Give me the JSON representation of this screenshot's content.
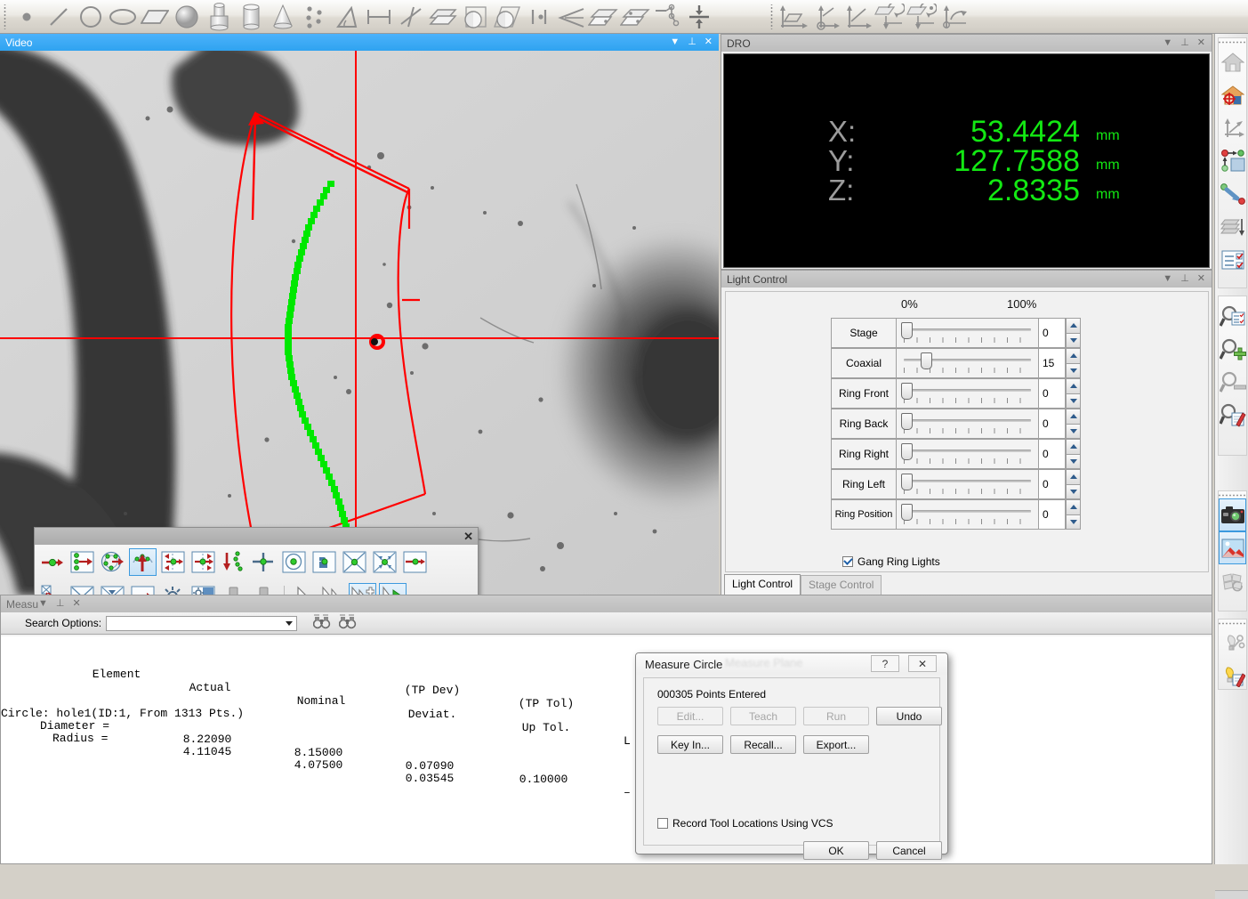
{
  "app": {
    "colors": {
      "active_title": "#3FA9F5",
      "inactive_title": "#C4C4C4",
      "dro_value": "#13E813",
      "dro_label": "#9B9B9B",
      "overlay_red": "#FF0000",
      "overlay_green": "#00E800",
      "selection_blue": "#3C9ADE"
    }
  },
  "top_toolbar": {
    "groups": [
      {
        "name": "geometry-primitives",
        "buttons": [
          {
            "name": "point-icon",
            "tip": "Point"
          },
          {
            "name": "line-icon",
            "tip": "Line"
          },
          {
            "name": "circle-icon",
            "tip": "Circle"
          },
          {
            "name": "ellipse-icon",
            "tip": "Ellipse"
          },
          {
            "name": "plane-icon",
            "tip": "Plane"
          },
          {
            "name": "sphere-icon",
            "tip": "Sphere"
          },
          {
            "name": "cylinder-step-icon",
            "tip": "Stepped Cylinder"
          },
          {
            "name": "cylinder-icon",
            "tip": "Cylinder"
          },
          {
            "name": "cone-icon",
            "tip": "Cone"
          },
          {
            "name": "point-cloud-icon",
            "tip": "Point Cloud"
          },
          {
            "name": "angle-icon",
            "tip": "Angle"
          },
          {
            "name": "distance-icon",
            "tip": "Distance"
          },
          {
            "name": "intersect-line-icon",
            "tip": "Intersection"
          },
          {
            "name": "plane-offset-icon",
            "tip": "Offset Plane"
          },
          {
            "name": "sphere-project-icon",
            "tip": "Project to Sphere"
          },
          {
            "name": "sphere-project-plane-icon",
            "tip": "Project Sphere to Plane"
          },
          {
            "name": "symmetry-icon",
            "tip": "Symmetry"
          },
          {
            "name": "cone-angle-icon",
            "tip": "Cone Angle"
          },
          {
            "name": "plane-dot-icon",
            "tip": "Plane Feature"
          },
          {
            "name": "plane-dot2-icon",
            "tip": "Plane Feature 2"
          },
          {
            "name": "chain-point-icon",
            "tip": "Chain Point"
          },
          {
            "name": "midplane-icon",
            "tip": "Mid Plane"
          }
        ]
      },
      {
        "name": "coordinate-systems",
        "buttons": [
          {
            "name": "align-plane-axis-icon",
            "tip": "Align Plane to Axis"
          },
          {
            "name": "align-origin-icon",
            "tip": "Set Origin"
          },
          {
            "name": "align-axis-icon",
            "tip": "Align Axis"
          },
          {
            "name": "rotate-csys-icon",
            "tip": "Rotate Coordinate System"
          },
          {
            "name": "rotate-csys-2-icon",
            "tip": "Rotate Coordinate System 2"
          },
          {
            "name": "csys-level-icon",
            "tip": "Level Coordinate System"
          }
        ]
      }
    ]
  },
  "video_panel": {
    "title": "Video",
    "active": true,
    "title_buttons": [
      "menu-chevron",
      "pin",
      "close"
    ],
    "overlay": {
      "crosshair_label": "stage-crosshair",
      "measurement_tool": "arc-scan-region",
      "detected_points_color": "#00E800",
      "search_region_color": "#FF0000"
    }
  },
  "floating_toolbar": {
    "name": "measurement-tools-palette",
    "close_label": "✕",
    "row1": [
      {
        "name": "tool-point-probe",
        "selected": false
      },
      {
        "name": "tool-multi-point-line",
        "selected": false
      },
      {
        "name": "tool-circle-scan",
        "selected": false
      },
      {
        "name": "tool-arc-scan",
        "selected": true
      },
      {
        "name": "tool-edge-left",
        "selected": false
      },
      {
        "name": "tool-edge-right",
        "selected": false
      },
      {
        "name": "tool-point-chain",
        "selected": false
      },
      {
        "name": "tool-crosshair-target",
        "selected": false
      },
      {
        "name": "tool-circle-center",
        "selected": false
      },
      {
        "name": "tool-pattern-match",
        "selected": false
      },
      {
        "name": "tool-box-scan",
        "selected": false
      },
      {
        "name": "tool-radial-scan",
        "selected": false
      },
      {
        "name": "tool-linear-scan",
        "selected": false
      }
    ],
    "row2": [
      {
        "name": "tool-measure-network",
        "selected": false
      },
      {
        "name": "tool-box-cross",
        "selected": false
      },
      {
        "name": "tool-box-converge",
        "selected": false
      },
      {
        "name": "tool-direction-arrow",
        "selected": false
      },
      {
        "name": "tool-brightness",
        "selected": false
      },
      {
        "name": "tool-contrast",
        "selected": false
      },
      {
        "name": "tool-touch-probe",
        "selected": false
      },
      {
        "name": "tool-touch-probe-2",
        "selected": false
      },
      {
        "name": "tool-select-pointer",
        "selected": false
      },
      {
        "name": "tool-multi-select",
        "selected": false
      },
      {
        "name": "tool-add-select",
        "selected": true
      },
      {
        "name": "tool-run-select",
        "selected": true
      }
    ]
  },
  "dro": {
    "title": "DRO",
    "title_buttons": [
      "menu-chevron",
      "pin",
      "close"
    ],
    "axes": [
      {
        "label": "X:",
        "value": "53.4424",
        "unit": "mm"
      },
      {
        "label": "Y:",
        "value": "127.7588",
        "unit": "mm"
      },
      {
        "label": "Z:",
        "value": "2.8335",
        "unit": "mm"
      }
    ]
  },
  "light_control": {
    "title": "Light Control",
    "title_buttons": [
      "menu-chevron",
      "pin",
      "close"
    ],
    "scale_min": "0%",
    "scale_max": "100%",
    "channels": [
      {
        "label": "Stage",
        "value": "0",
        "pct": 0
      },
      {
        "label": "Coaxial",
        "value": "15",
        "pct": 15
      },
      {
        "label": "Ring Front",
        "value": "0",
        "pct": 0
      },
      {
        "label": "Ring Back",
        "value": "0",
        "pct": 0
      },
      {
        "label": "Ring Right",
        "value": "0",
        "pct": 0
      },
      {
        "label": "Ring Left",
        "value": "0",
        "pct": 0
      },
      {
        "label": "Ring Position",
        "value": "0",
        "pct": 0
      }
    ],
    "gang_ring_lights": {
      "label": "Gang Ring Lights",
      "checked": true
    },
    "tabs": [
      {
        "label": "Light Control",
        "active": true
      },
      {
        "label": "Stage Control",
        "active": false
      }
    ]
  },
  "measure_panel": {
    "title": "Measu",
    "title_buttons": [
      "menu-chevron",
      "pin",
      "close"
    ],
    "search_options": {
      "label": "Search Options:",
      "value": "",
      "placeholder": ""
    },
    "search_icons": [
      "find-icon",
      "find-next-icon"
    ],
    "results": {
      "headers": [
        {
          "line1": "Element",
          "line2": ""
        },
        {
          "line1": "Actual",
          "line2": ""
        },
        {
          "line1": "Nominal",
          "line2": ""
        },
        {
          "line1": "Deviat.",
          "line2": "(TP Dev)"
        },
        {
          "line1": "Up Tol.",
          "line2": "(TP Tol)"
        },
        {
          "line1": "L",
          "line2": ""
        }
      ],
      "feature_line": "Circle: hole1(ID:1, From 1313 Pts.)",
      "rows": [
        {
          "label": "Diameter =",
          "actual": "8.22090",
          "nominal": "8.15000",
          "deviat": "0.07090",
          "uptol": "0.10000",
          "lowtol": "–"
        },
        {
          "label": "Radius =",
          "actual": "4.11045",
          "nominal": "4.07500",
          "deviat": "0.03545",
          "uptol": "",
          "lowtol": ""
        }
      ]
    }
  },
  "measure_circle_dialog": {
    "title": "Measure Circle",
    "ghost_title": "Measure Plane",
    "help_button": "?",
    "close_button": "✕",
    "points_entered": "000305 Points Entered",
    "buttons": [
      {
        "label": "Edit...",
        "name": "edit-button",
        "enabled": false
      },
      {
        "label": "Teach",
        "name": "teach-button",
        "enabled": false
      },
      {
        "label": "Run",
        "name": "run-button",
        "enabled": false
      },
      {
        "label": "Undo",
        "name": "undo-button",
        "enabled": true
      },
      {
        "label": "Key In...",
        "name": "key-in-button",
        "enabled": true
      },
      {
        "label": "Recall...",
        "name": "recall-button",
        "enabled": true
      },
      {
        "label": "Export...",
        "name": "export-button",
        "enabled": true
      }
    ],
    "vcs_checkbox": {
      "label": "Record Tool Locations Using VCS",
      "checked": false
    },
    "ok_label": "OK",
    "cancel_label": "Cancel"
  },
  "right_toolbar": {
    "groups": [
      {
        "name": "machine-nav",
        "buttons": [
          {
            "name": "home-icon",
            "selected": false
          },
          {
            "name": "home-datum-icon",
            "selected": false
          },
          {
            "name": "axis-align-icon",
            "selected": false
          },
          {
            "name": "move-to-point-icon",
            "selected": false
          },
          {
            "name": "goto-position-icon",
            "selected": false
          },
          {
            "name": "layer-stack-icon",
            "selected": false
          },
          {
            "name": "checklist-icon",
            "selected": false
          }
        ]
      },
      {
        "name": "zoom-tools",
        "buttons": [
          {
            "name": "zoom-list-icon",
            "selected": false
          },
          {
            "name": "zoom-in-icon",
            "selected": false
          },
          {
            "name": "zoom-out-icon",
            "selected": false
          },
          {
            "name": "zoom-edit-icon",
            "selected": false
          }
        ]
      },
      {
        "name": "capture-tools",
        "buttons": [
          {
            "name": "camera-icon",
            "selected": true
          },
          {
            "name": "image-icon",
            "selected": true
          },
          {
            "name": "stitch-icon",
            "selected": false
          }
        ]
      },
      {
        "name": "illumination-tools",
        "buttons": [
          {
            "name": "lamp-settings-icon",
            "selected": false
          },
          {
            "name": "lamp-edit-icon",
            "selected": false
          }
        ]
      }
    ]
  }
}
